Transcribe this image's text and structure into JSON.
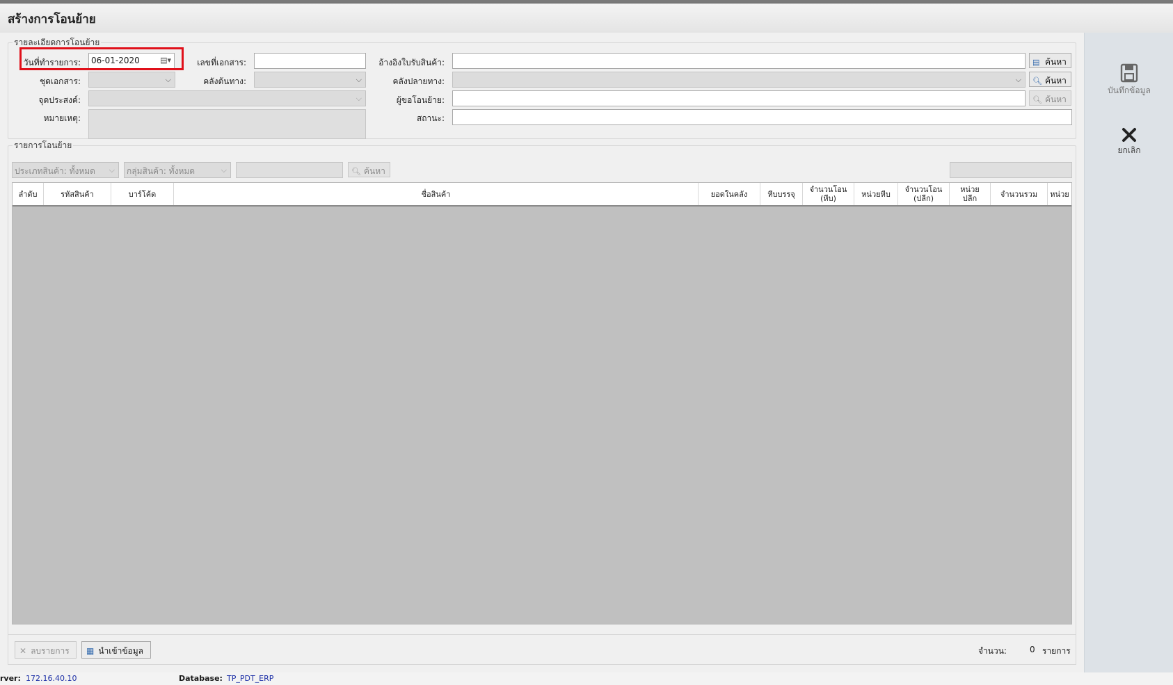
{
  "window": {
    "title": "สร้างการโอนย้าย"
  },
  "header_group": {
    "legend": "รายละเอียดการโอนย้าย",
    "date_label": "วันที่ทำรายการ:",
    "date_value": "06-01-2020",
    "doc_no_label": "เลขที่เอกสาร:",
    "doc_no_value": "",
    "ref_receipt_label": "อ้างอิงใบรับสินค้า:",
    "ref_receipt_value": "",
    "doc_set_label": "ชุดเอกสาร:",
    "source_wh_label": "คลังต้นทาง:",
    "dest_wh_label": "คลังปลายทาง:",
    "purpose_label": "จุดประสงค์:",
    "requester_label": "ผู้ขอโอนย้าย:",
    "requester_value": "",
    "note_label": "หมายเหตุ:",
    "status_label": "สถานะ:",
    "status_value": "",
    "search_label": "ค้นหา"
  },
  "items_group": {
    "legend": "รายการโอนย้าย",
    "product_type_filter": "ประเภทสินค้า: ทั้งหมด",
    "product_group_filter": "กลุ่มสินค้า: ทั้งหมด",
    "search_label": "ค้นหา",
    "columns": [
      "ลำดับ",
      "รหัสสินค้า",
      "บาร์โค้ด",
      "ชื่อสินค้า",
      "ยอดในคลัง",
      "หีบบรรจุ",
      "จำนวนโอน\n(หีบ)",
      "หน่วยหีบ",
      "จำนวนโอน\n(ปลีก)",
      "หน่วย\nปลีก",
      "จำนวนรวม",
      "หน่วย"
    ]
  },
  "right_panel": {
    "save_label": "บันทึกข้อมูล",
    "cancel_label": "ยกเลิก"
  },
  "bottom": {
    "delete_label": "ลบรายการ",
    "import_label": "นำเข้าข้อมูล",
    "count_label": "จำนวน:",
    "count_value": "0",
    "count_unit": "รายการ"
  },
  "statusbar": {
    "server_label": "rver:",
    "server_value": "172.16.40.10",
    "database_label": "Database:",
    "database_value": "TP_PDT_ERP"
  }
}
